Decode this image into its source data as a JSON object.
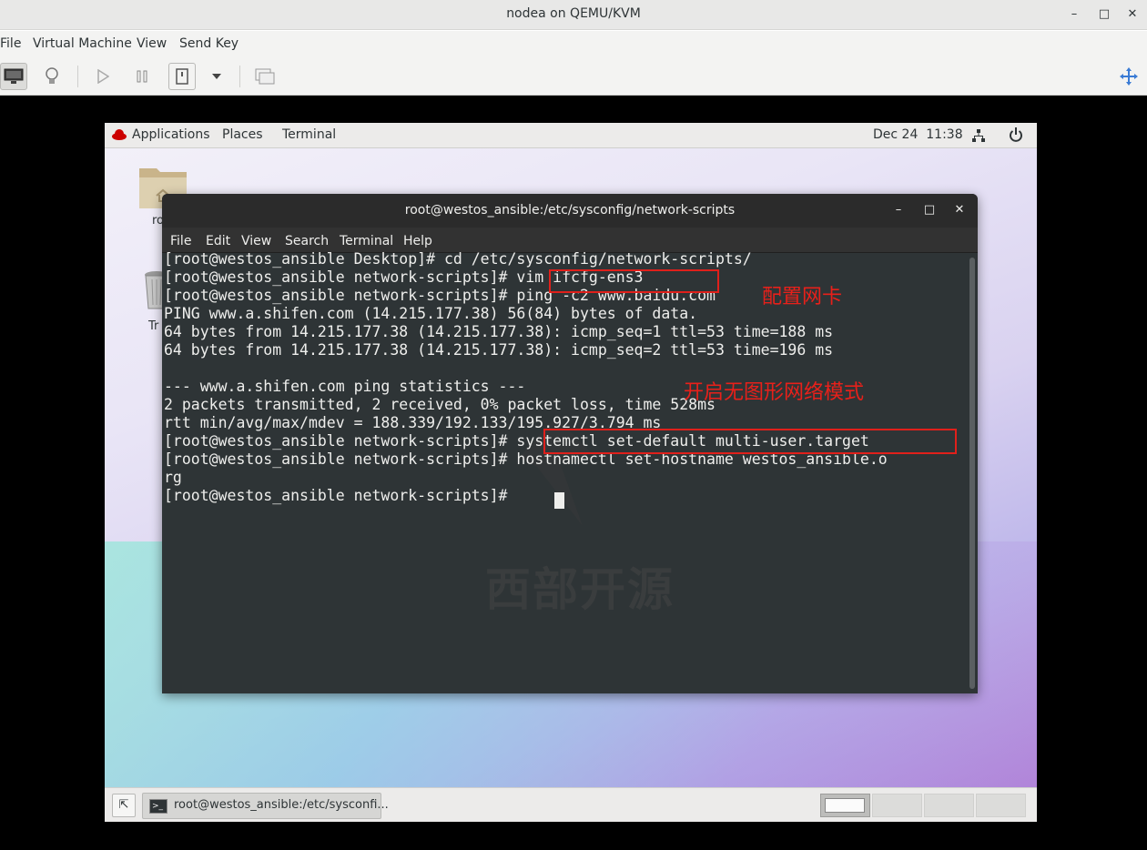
{
  "host": {
    "title": "nodea on QEMU/KVM",
    "window_controls": {
      "minimize": "–",
      "maximize": "□",
      "close": "✕"
    },
    "menu": [
      "File",
      "Virtual Machine",
      "View",
      "Send Key"
    ]
  },
  "guest_topbar": {
    "applications": "Applications",
    "places": "Places",
    "terminal": "Terminal",
    "clock": "Dec 24  11:38"
  },
  "desktop": {
    "folder_label": "ro",
    "trash_label": "Tr"
  },
  "terminal": {
    "title": "root@westos_ansible:/etc/sysconfig/network-scripts",
    "menu": [
      "File",
      "Edit",
      "View",
      "Search",
      "Terminal",
      "Help"
    ],
    "lines": [
      "[root@westos_ansible Desktop]# cd /etc/sysconfig/network-scripts/",
      "[root@westos_ansible network-scripts]# vim ifcfg-ens3",
      "[root@westos_ansible network-scripts]# ping -c2 www.baidu.com",
      "PING www.a.shifen.com (14.215.177.38) 56(84) bytes of data.",
      "64 bytes from 14.215.177.38 (14.215.177.38): icmp_seq=1 ttl=53 time=188 ms",
      "64 bytes from 14.215.177.38 (14.215.177.38): icmp_seq=2 ttl=53 time=196 ms",
      "",
      "--- www.a.shifen.com ping statistics ---",
      "2 packets transmitted, 2 received, 0% packet loss, time 528ms",
      "rtt min/avg/max/mdev = 188.339/192.133/195.927/3.794 ms",
      "[root@westos_ansible network-scripts]# systemctl set-default multi-user.target",
      "[root@westos_ansible network-scripts]# hostnamectl set-hostname westos_ansible.o",
      "rg",
      "[root@westos_ansible network-scripts]# "
    ],
    "annotations": {
      "configure_nic": "配置网卡",
      "headless_mode": "开启无图形网络模式"
    },
    "watermark": "西部开源"
  },
  "taskbar": {
    "task_label": "root@westos_ansible:/etc/sysconfi..."
  }
}
